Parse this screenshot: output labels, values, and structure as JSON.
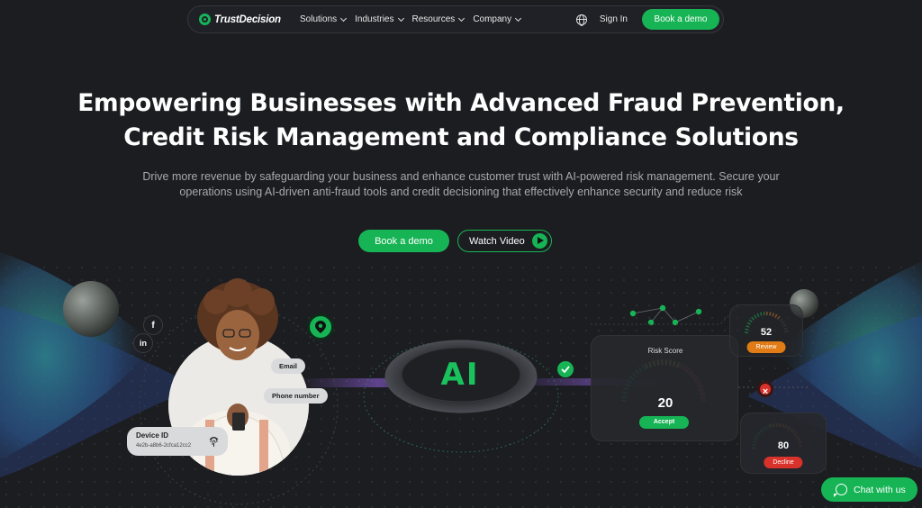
{
  "brand": {
    "name": "TrustDecision",
    "accent": "#17b455",
    "background": "#1c1d21"
  },
  "nav": {
    "items": [
      {
        "label": "Solutions"
      },
      {
        "label": "Industries"
      },
      {
        "label": "Resources"
      },
      {
        "label": "Company"
      }
    ],
    "language_icon": "globe-icon",
    "signin_label": "Sign In",
    "demo_label": "Book a demo"
  },
  "hero": {
    "title_line1": "Empowering Businesses with Advanced Fraud Prevention,",
    "title_line2": "Credit Risk Management and Compliance Solutions",
    "subtitle_line1": "Drive more revenue by safeguarding your business and enhance customer trust with AI-powered risk management. Secure your",
    "subtitle_line2": "operations using AI-driven anti-fraud tools and credit decisioning that effectively enhance security and reduce risk",
    "cta_demo": "Book a demo",
    "cta_video": "Watch Video"
  },
  "illustration": {
    "social_facebook": "f",
    "social_linkedin": "in",
    "tag_email": "Email",
    "tag_phone": "Phone number",
    "device_title": "Device ID",
    "device_value": "4e2b-a8b6-2cfca12cc2",
    "ai_label": "AI",
    "risk_title": "Risk Score",
    "risk_value": "20",
    "risk_status": "Accept",
    "review_value": "52",
    "review_status": "Review",
    "decline_value": "80",
    "decline_status": "Decline",
    "review_color": "#e07b16",
    "decline_color": "#d9322b"
  },
  "chat": {
    "label": "Chat with us",
    "icon": "whatsapp-icon"
  }
}
